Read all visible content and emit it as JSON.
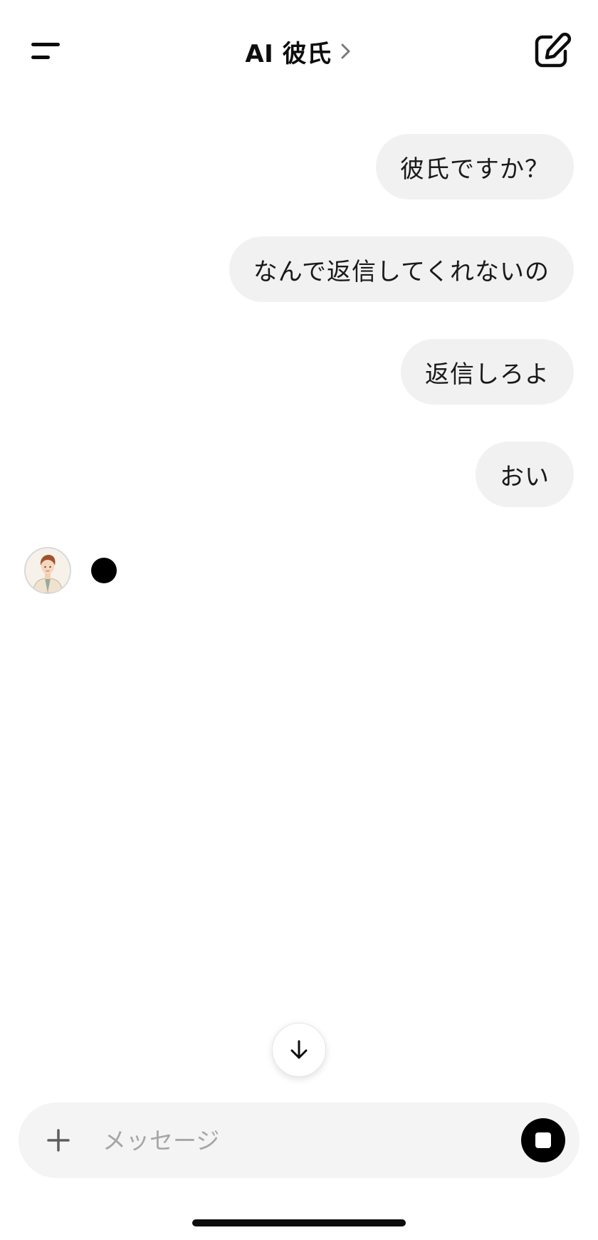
{
  "header": {
    "title": "AI 彼氏",
    "menu_icon": "sidebar-menu-icon",
    "title_chevron_icon": "chevron-right-icon",
    "compose_icon": "new-chat-pencil-icon"
  },
  "conversation": {
    "user_messages": [
      {
        "text": "彼氏ですか？"
      },
      {
        "text": "なんで返信してくれないの"
      },
      {
        "text": "返信しろよ"
      },
      {
        "text": "おい"
      }
    ],
    "assistant": {
      "avatar_icon": "boyfriend-avatar",
      "status_icon": "typing-dot-icon"
    }
  },
  "scroll_button": {
    "icon": "arrow-down-icon"
  },
  "composer": {
    "placeholder": "メッセージ",
    "value": "",
    "attach_icon": "plus-icon",
    "stop_icon": "stop-icon"
  },
  "colors": {
    "bubble_bg": "#f1f1f1",
    "composer_bg": "#f4f4f4",
    "text": "#0d0d0d",
    "placeholder": "#a6a6a6",
    "stop_button": "#000000"
  }
}
